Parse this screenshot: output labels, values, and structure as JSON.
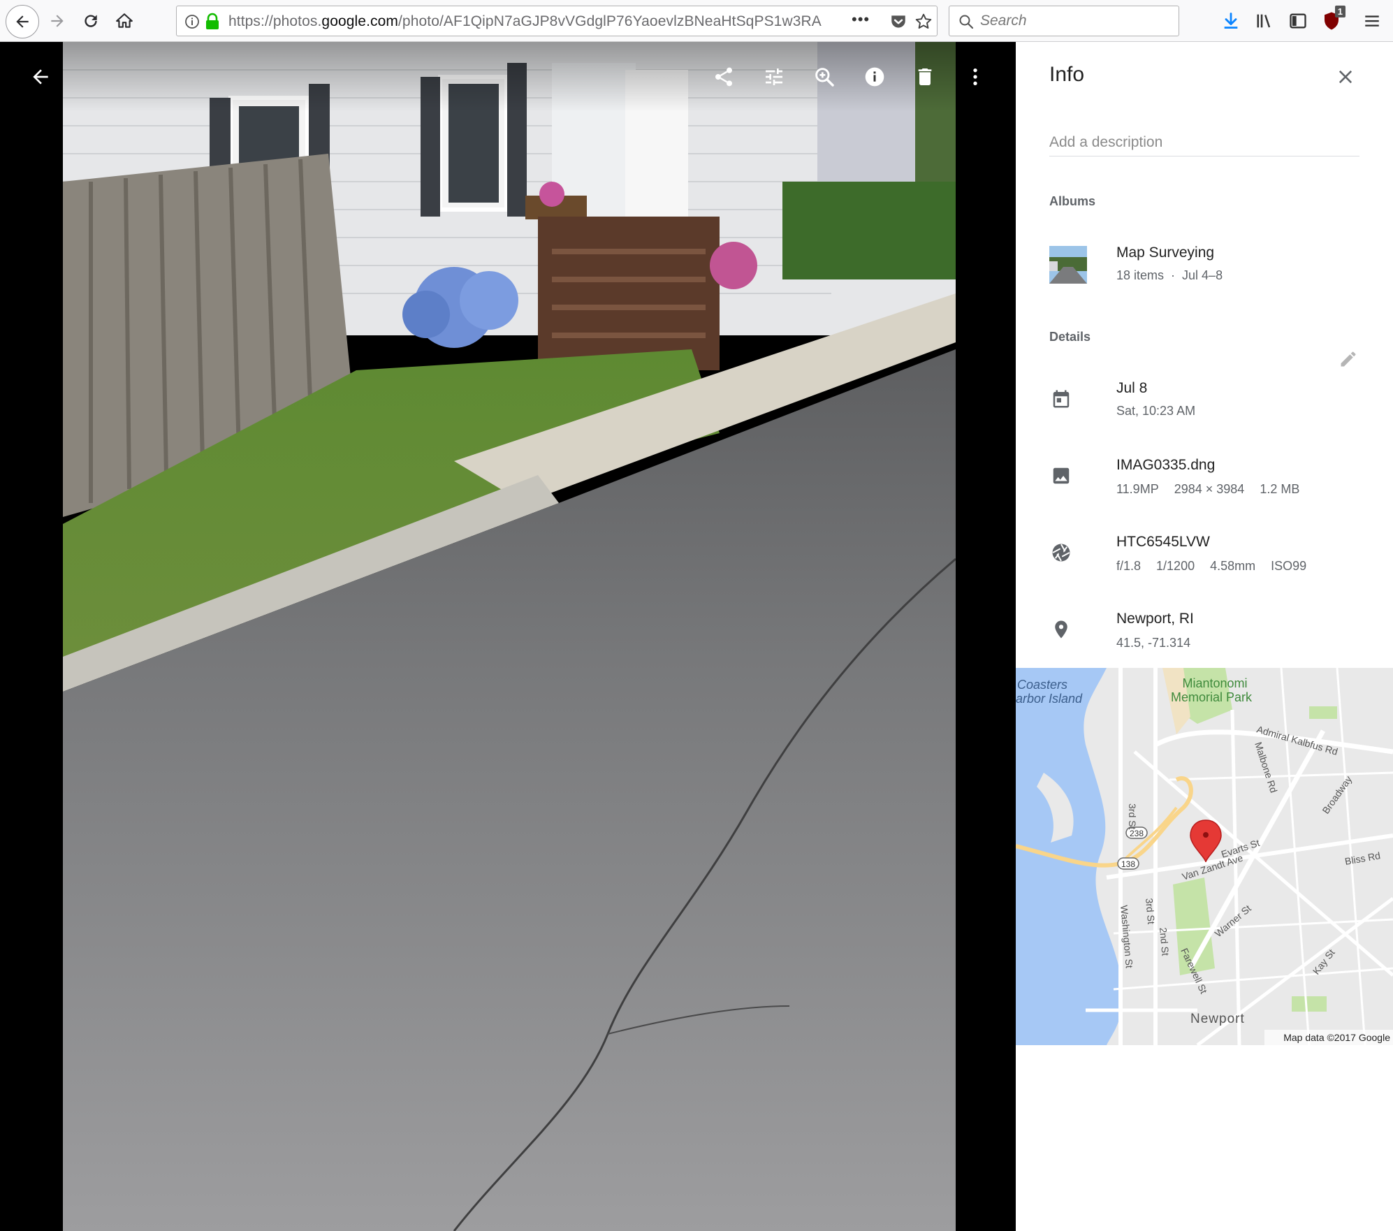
{
  "browser": {
    "url_prefix": "https://photos.",
    "url_domain": "google.com",
    "url_path": "/photo/AF1QipN7aGJP8vVGdglP76YaoevlzBNeaHtSqPS1w3RA",
    "page_actions_glyph": "•••",
    "search_placeholder": "Search",
    "ublock_count": "1"
  },
  "viewer": {
    "tools": [
      "share",
      "edit",
      "zoom",
      "info",
      "delete",
      "more"
    ]
  },
  "info": {
    "title": "Info",
    "description_placeholder": "Add a description",
    "albums_heading": "Albums",
    "album": {
      "name": "Map Surveying",
      "count": "18 items",
      "separator": "·",
      "dates": "Jul 4–8"
    },
    "details_heading": "Details",
    "date": {
      "primary": "Jul 8",
      "secondary": "Sat, 10:23 AM"
    },
    "file": {
      "name": "IMAG0335.dng",
      "megapixels": "11.9MP",
      "resolution": "2984 × 3984",
      "size": "1.2 MB"
    },
    "camera": {
      "model": "HTC6545LVW",
      "aperture": "f/1.8",
      "shutter": "1/1200",
      "focal": "4.58mm",
      "iso": "ISO99"
    },
    "location": {
      "place": "Newport, RI",
      "coords": "41.5, -71.314"
    }
  },
  "map": {
    "labels": {
      "coasters": "Coasters",
      "harbor": "arbor Island",
      "park1": "Miantonomi",
      "park2": "Memorial Park",
      "admiral": "Admiral Kalbfus Rd",
      "malbone": "Malbone Rd",
      "broadway": "Broadway",
      "third_st": "3rd St",
      "third_st_2": "3rd St",
      "second_st": "2nd St",
      "rt238": "238",
      "rt138": "138",
      "evarts": "Evarts St",
      "van_zandt": "Van Zandt Ave",
      "bliss": "Bliss Rd",
      "warner": "Warner St",
      "washington": "Washington St",
      "farewell": "Farewell St",
      "kay": "Kay St",
      "newport": "Newport",
      "attribution": "Map data ©2017 Google"
    }
  },
  "colors": {
    "water": "#a6c8f5",
    "park": "#c5e3a8",
    "road": "#ffffff",
    "highway": "#f9d58a",
    "pin": "#e53935"
  }
}
